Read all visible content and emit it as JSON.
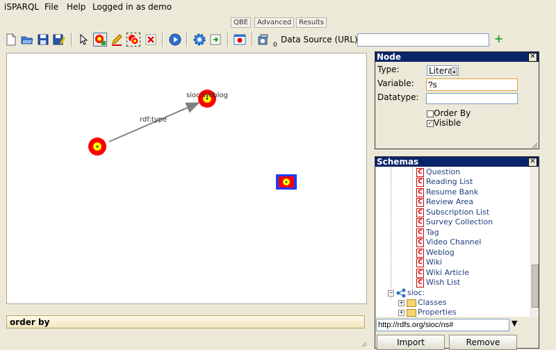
{
  "menubar": {
    "app_name": "iSPARQL",
    "file": "File",
    "help": "Help",
    "login_status": "Logged in as demo"
  },
  "tabs": [
    {
      "label": "QBE"
    },
    {
      "label": "Advanced"
    },
    {
      "label": "Results"
    }
  ],
  "toolbar": {
    "datasource_label": "Data Source (URL):",
    "datasource_value": "",
    "count_badge": "0",
    "add_icon": "plus-icon"
  },
  "canvas": {
    "edge_label": "rdf:type",
    "node_label": "sioc:Weblog"
  },
  "order_by": {
    "label": "order by"
  },
  "node_panel": {
    "title": "Node",
    "type_label": "Type:",
    "type_value": "Literal",
    "variable_label": "Variable:",
    "variable_value": "?s",
    "datatype_label": "Datatype:",
    "datatype_value": "",
    "order_by_label": "Order By",
    "visible_label": "Visible",
    "order_by_checked": false,
    "visible_checked": true
  },
  "schemas_panel": {
    "title": "Schemas",
    "classes": [
      "Question",
      "Reading List",
      "Resume Bank",
      "Review Area",
      "Subscription List",
      "Survey Collection",
      "Tag",
      "Video Channel",
      "Weblog",
      "Wiki",
      "Wiki Article",
      "Wish List"
    ],
    "namespace": "sioc:",
    "classes_folder": "Classes",
    "properties_folder": "Properties",
    "url_value": "http://rdfs.org/sioc/ns#",
    "import_button": "Import",
    "remove_button": "Remove"
  },
  "colors": {
    "panel_title_bg": "#0a246a",
    "node_red": "#ff0000",
    "node_yellow": "#ffff00",
    "selected_blue": "#1e3cff"
  }
}
